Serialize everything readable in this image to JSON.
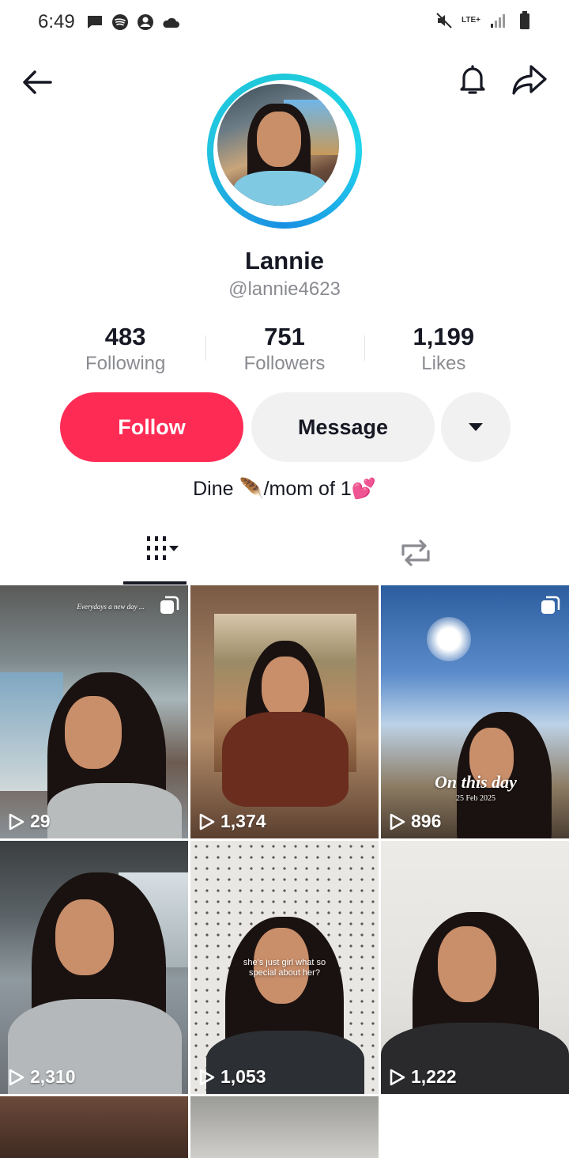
{
  "status": {
    "time": "6:49",
    "network": "LTE+"
  },
  "profile": {
    "display_name": "Lannie",
    "handle": "@lannie4623",
    "bio": "Dine 🪶/mom of 1💕"
  },
  "stats": [
    {
      "number": "483",
      "label": "Following"
    },
    {
      "number": "751",
      "label": "Followers"
    },
    {
      "number": "1,199",
      "label": "Likes"
    }
  ],
  "actions": {
    "follow_label": "Follow",
    "message_label": "Message"
  },
  "colors": {
    "follow_bg": "#fe2c55",
    "secondary_bg": "#f1f1f2",
    "ring": "#20d5ec",
    "muted_text": "#8a8b91"
  },
  "videos": [
    {
      "views": "29",
      "caption": "Everydays a new day ..."
    },
    {
      "views": "1,374",
      "caption": ""
    },
    {
      "views": "896",
      "caption": "On this day",
      "date": "25 Feb 2025"
    },
    {
      "views": "2,310",
      "caption": ""
    },
    {
      "views": "1,053",
      "caption": "she's just girl what so special about her?"
    },
    {
      "views": "1,222",
      "caption": ""
    }
  ]
}
